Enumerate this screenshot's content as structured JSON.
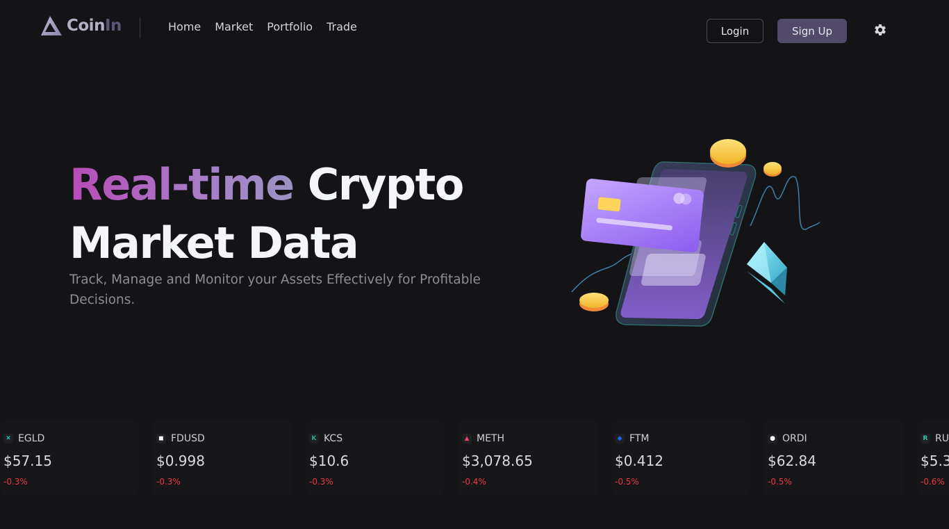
{
  "brand": {
    "name_part1": "Coin",
    "name_part2": "In",
    "logo_icon": "triangle-logo-icon"
  },
  "nav": [
    {
      "label": "Home"
    },
    {
      "label": "Market"
    },
    {
      "label": "Portfolio"
    },
    {
      "label": "Trade"
    }
  ],
  "auth": {
    "login_label": "Login",
    "signup_label": "Sign Up"
  },
  "settings": {
    "icon": "gear-icon"
  },
  "hero": {
    "title_highlight": "Real-time",
    "title_rest_line1": " Crypto",
    "title_line2": "Market Data",
    "subtitle": "Track, Manage and Monitor your Assets Effectively for Profitable Decisions."
  },
  "colors": {
    "background": "#141416",
    "accent_gradient_start": "#b94bb8",
    "accent_gradient_end": "#9a92c2",
    "signup_button": "#514a6a",
    "negative_change": "#ea3943"
  },
  "ticker": [
    {
      "symbol": "EGLD",
      "price": "$57.15",
      "change": "-0.3%",
      "icon": "egld-icon",
      "icon_color": "#23f7dd"
    },
    {
      "symbol": "FDUSD",
      "price": "$0.998",
      "change": "-0.3%",
      "icon": "fdusd-icon",
      "icon_color": "#ffffff"
    },
    {
      "symbol": "KCS",
      "price": "$10.6",
      "change": "-0.3%",
      "icon": "kcs-icon",
      "icon_color": "#23af91"
    },
    {
      "symbol": "METH",
      "price": "$3,078.65",
      "change": "-0.4%",
      "icon": "meth-icon",
      "icon_color": "#e8415a"
    },
    {
      "symbol": "FTM",
      "price": "$0.412",
      "change": "-0.5%",
      "icon": "ftm-icon",
      "icon_color": "#1969ff"
    },
    {
      "symbol": "ORDI",
      "price": "$62.84",
      "change": "-0.5%",
      "icon": "ordi-icon",
      "icon_color": "#ffffff"
    },
    {
      "symbol": "RU",
      "price": "$5.3",
      "change": "-0.6%",
      "icon": "rune-icon",
      "icon_color": "#33c9a8"
    }
  ]
}
